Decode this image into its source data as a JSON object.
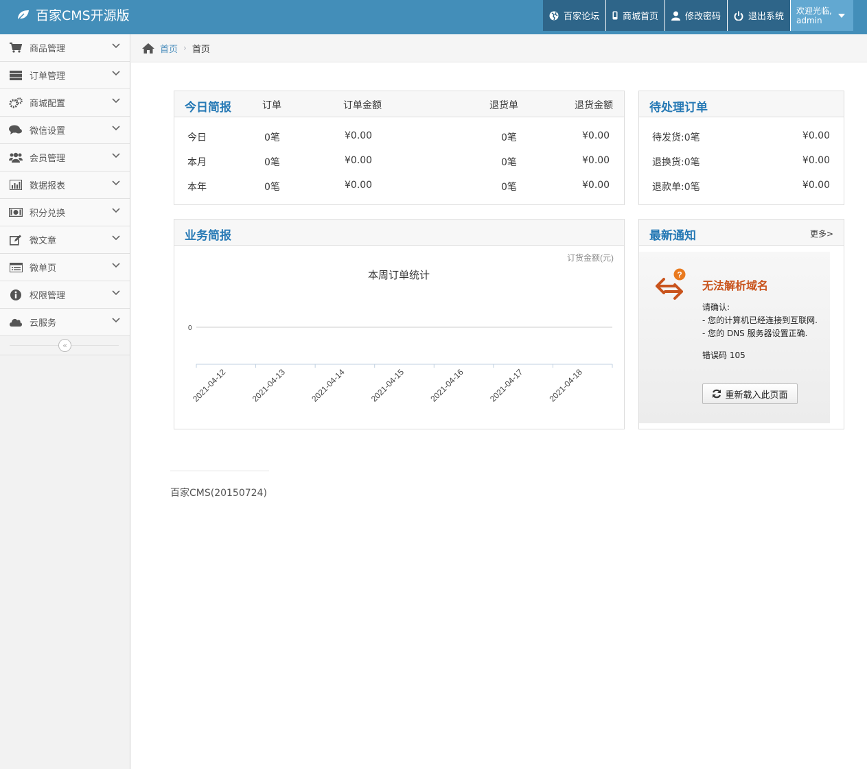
{
  "header": {
    "brand": "百家CMS开源版",
    "nav": [
      {
        "label": "百家论坛",
        "icon": "globe-icon"
      },
      {
        "label": "商城首页",
        "icon": "mobile-icon"
      },
      {
        "label": "修改密码",
        "icon": "user-icon"
      },
      {
        "label": "退出系统",
        "icon": "power-icon"
      }
    ],
    "welcome": "欢迎光临,",
    "username": "admin"
  },
  "sidebar": {
    "items": [
      {
        "label": "商品管理",
        "icon": "cart-icon"
      },
      {
        "label": "订单管理",
        "icon": "server-icon"
      },
      {
        "label": "商城配置",
        "icon": "cogs-icon"
      },
      {
        "label": "微信设置",
        "icon": "comments-icon"
      },
      {
        "label": "会员管理",
        "icon": "group-icon"
      },
      {
        "label": "数据报表",
        "icon": "bar-chart-icon"
      },
      {
        "label": "积分兑换",
        "icon": "money-icon"
      },
      {
        "label": "微文章",
        "icon": "edit-icon"
      },
      {
        "label": "微单页",
        "icon": "list-icon"
      },
      {
        "label": "权限管理",
        "icon": "info-icon"
      },
      {
        "label": "云服务",
        "icon": "cloud-icon"
      }
    ],
    "collapse_label": "«"
  },
  "breadcrumb": {
    "home": "首页",
    "current": "首页"
  },
  "today": {
    "title": "今日简报",
    "columns": [
      "订单",
      "订单金额",
      "退货单",
      "退货金额"
    ],
    "rows": [
      {
        "label": "今日",
        "orders": "0笔",
        "amount": "¥0.00",
        "returns": "0笔",
        "return_amount": "¥0.00"
      },
      {
        "label": "本月",
        "orders": "0笔",
        "amount": "¥0.00",
        "returns": "0笔",
        "return_amount": "¥0.00"
      },
      {
        "label": "本年",
        "orders": "0笔",
        "amount": "¥0.00",
        "returns": "0笔",
        "return_amount": "¥0.00"
      }
    ]
  },
  "pending": {
    "title": "待处理订单",
    "rows": [
      {
        "label": "待发货:0笔",
        "amount": "¥0.00"
      },
      {
        "label": "退换货:0笔",
        "amount": "¥0.00"
      },
      {
        "label": "退款单:0笔",
        "amount": "¥0.00"
      }
    ]
  },
  "business": {
    "title": "业务简报"
  },
  "chart_data": {
    "type": "line",
    "title": "本周订单统计",
    "ylabel": "订货金额(元)",
    "xlabel": "",
    "categories": [
      "2021-04-12",
      "2021-04-13",
      "2021-04-14",
      "2021-04-15",
      "2021-04-16",
      "2021-04-17",
      "2021-04-18"
    ],
    "yticks": [
      "0"
    ],
    "series": [
      {
        "values": [
          0,
          0,
          0,
          0,
          0,
          0,
          0
        ]
      }
    ]
  },
  "notice": {
    "title": "最新通知",
    "more": "更多>",
    "error_title": "无法解析域名",
    "error_lines": [
      "请确认:",
      "- 您的计算机已经连接到互联网.",
      "- 您的 DNS 服务器设置正确."
    ],
    "error_code": "错误码 105",
    "reload": "重新载入此页面"
  },
  "footer": {
    "text": "百家CMS(20150724)"
  },
  "colors": {
    "navbar": "#438eb9",
    "nav_item": "#2e6589",
    "user_box": "#62a8d1",
    "title": "#2679b5",
    "error": "#c9541d"
  }
}
